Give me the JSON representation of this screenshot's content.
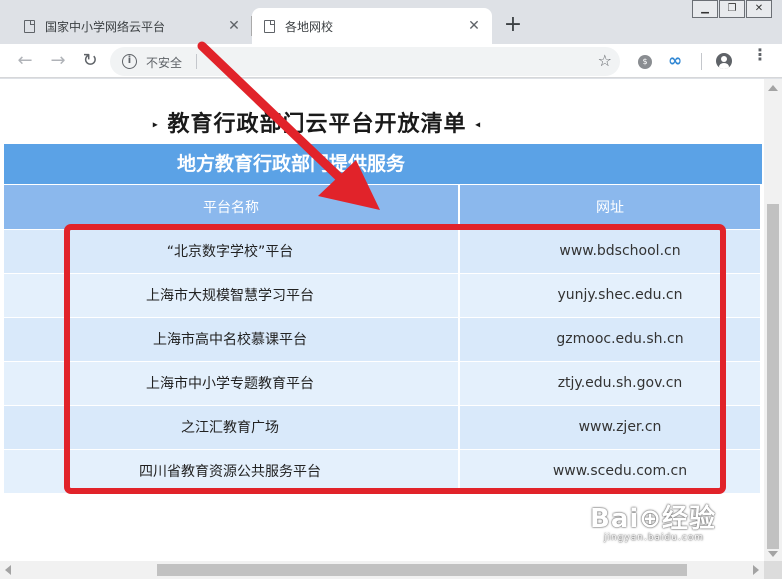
{
  "window_controls": [
    "▁",
    "❐",
    "✕"
  ],
  "tabs": [
    {
      "title": "国家中小学网络云平台",
      "close": "✕"
    },
    {
      "title": "各地网校",
      "close": "✕"
    }
  ],
  "new_tab": "+",
  "toolbar": {
    "back": "←",
    "forward": "→",
    "reload": "↻",
    "security_label": "不安全",
    "info_glyph": "i",
    "bookmark": "☆",
    "menu": "⋮",
    "ext_infinity": "∞",
    "ext_badge": "$"
  },
  "page": {
    "list_title": "教育行政部门云平台开放清单",
    "title_arrow_left": "▸",
    "title_arrow_right": "◂",
    "section_header": "地方教育行政部门提供服务",
    "table": {
      "headers": [
        "平台名称",
        "网址"
      ],
      "rows": [
        {
          "name": "“北京数字学校”平台",
          "url": "www.bdschool.cn"
        },
        {
          "name": "上海市大规模智慧学习平台",
          "url": "yunjy.shec.edu.cn"
        },
        {
          "name": "上海市高中名校慕课平台",
          "url": "gzmooc.edu.sh.cn"
        },
        {
          "name": "上海市中小学专题教育平台",
          "url": "ztjy.edu.sh.gov.cn"
        },
        {
          "name": "之江汇教育广场",
          "url": "www.zjer.cn"
        },
        {
          "name": "四川省教育资源公共服务平台",
          "url": "www.scedu.com.cn"
        }
      ]
    }
  },
  "watermark": {
    "main": "Bai⊕经验",
    "sub": "jingyan.baidu.com"
  },
  "colors": {
    "section_header_bg": "#5ba2e6",
    "table_header_bg": "#8bb8ed",
    "row_bg": "#d9e9fa",
    "highlight_red": "#e1232a"
  }
}
